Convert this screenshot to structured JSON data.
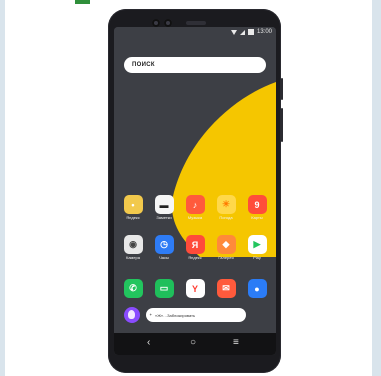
{
  "statusbar": {
    "time": "13:00"
  },
  "search": {
    "placeholder": "ПОИСК"
  },
  "apps": [
    {
      "label": "Яндекс",
      "icon": "cat-face-icon",
      "color": "#f2c94c"
    },
    {
      "label": "Заметки",
      "icon": "note-icon",
      "color": "#f6f6f6"
    },
    {
      "label": "Музыка",
      "icon": "music-icon",
      "color": "#ff5a3c"
    },
    {
      "label": "Погода",
      "icon": "weather-icon",
      "color": "#ffd84a"
    },
    {
      "label": "Карты",
      "icon": "map-pin-icon",
      "color": "#ff4d3a"
    },
    {
      "label": "Камера",
      "icon": "camera-icon",
      "color": "#e8e8e8"
    },
    {
      "label": "Часы",
      "icon": "clock-icon",
      "color": "#2e7cf6"
    },
    {
      "label": "Яндекс",
      "icon": "yandex-y-icon",
      "color": "#ff4b3a"
    },
    {
      "label": "Галерея",
      "icon": "gallery-icon",
      "color": "#ff8a3a"
    },
    {
      "label": "Play",
      "icon": "play-store-icon",
      "color": "#ffffff"
    },
    {
      "label": "",
      "icon": "phone-icon",
      "color": "#22c55e"
    },
    {
      "label": "",
      "icon": "messages-icon",
      "color": "#1fbf5b"
    },
    {
      "label": "",
      "icon": "browser-y-icon",
      "color": "#ffffff"
    },
    {
      "label": "",
      "icon": "mail-icon",
      "color": "#ff5a3c"
    },
    {
      "label": "",
      "icon": "circle-app-icon",
      "color": "#2b7cf6"
    }
  ],
  "assistant": {
    "prompt": "«Ж»…Заблокировать"
  },
  "nav": {
    "back": "‹",
    "home": "○",
    "menu": "≡"
  },
  "colors": {
    "wallpaper_yellow": "#f5c600",
    "wallpaper_dark": "#3d3f45"
  }
}
